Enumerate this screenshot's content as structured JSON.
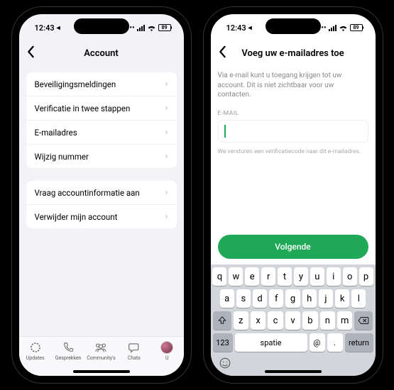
{
  "status": {
    "time": "12:43",
    "nav_indicator": "◂",
    "signal_dots": "••",
    "battery": "89"
  },
  "left": {
    "title": "Account",
    "items1": [
      "Beveiligingsmeldingen",
      "Verificatie in twee stappen",
      "E-mailadres",
      "Wijzig nummer"
    ],
    "items2": [
      "Vraag accountinformatie aan",
      "Verwijder mijn account"
    ],
    "tabs": [
      "Updates",
      "Gesprekken",
      "Community's",
      "Chats",
      "U"
    ]
  },
  "right": {
    "title": "Voeg uw e-mailadres toe",
    "intro": "Via e-mail kunt u toegang krijgen tot uw account. Dit is niet zichtbaar voor uw contacten.",
    "field_label": "E-MAIL",
    "helper": "We versturen een verificatiecode naar dit e-mailadres.",
    "next": "Volgende",
    "kb": {
      "r1": [
        "q",
        "w",
        "e",
        "r",
        "t",
        "y",
        "u",
        "i",
        "o",
        "p"
      ],
      "r2": [
        "a",
        "s",
        "d",
        "f",
        "g",
        "h",
        "j",
        "k",
        "l"
      ],
      "r3": [
        "z",
        "x",
        "c",
        "v",
        "b",
        "n",
        "m"
      ],
      "r4": {
        "k123": "123",
        "spatie": "spatie",
        "at": "@",
        "dot": ".",
        "return": "return"
      }
    }
  }
}
